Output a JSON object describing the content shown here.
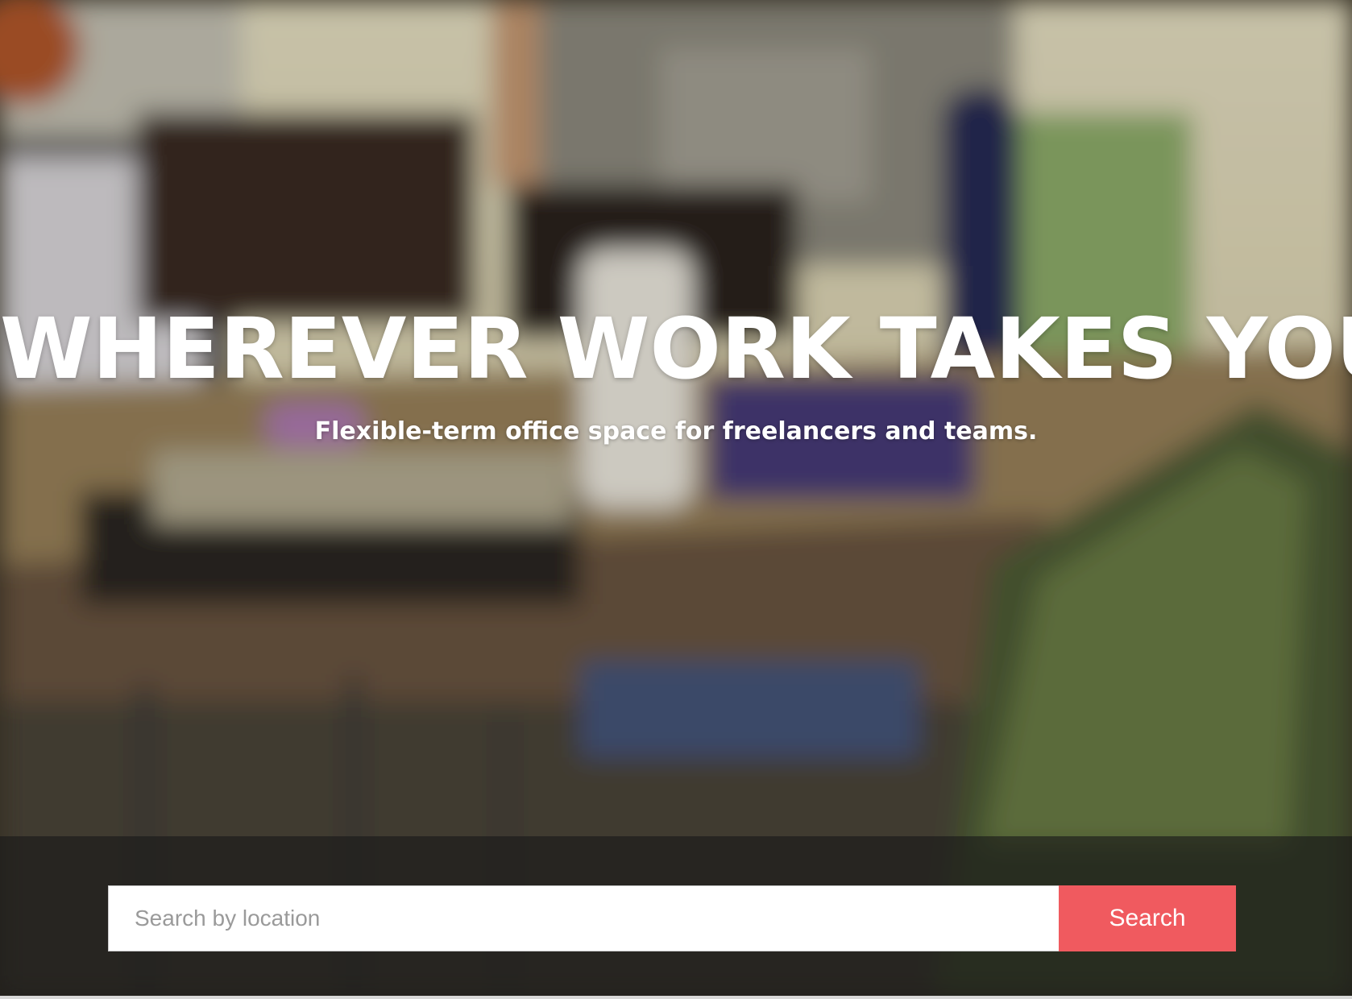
{
  "hero": {
    "title": "WHEREVER WORK TAKES YOU",
    "subtitle": "Flexible-term office space for freelancers and teams.",
    "background_image": "blurred-office-coworking-photo"
  },
  "search": {
    "placeholder": "Search by location",
    "value": "",
    "button_label": "Search"
  },
  "colors": {
    "accent": "#f05a5f",
    "text_on_image": "#ffffff",
    "overlay_band": "#191919"
  }
}
